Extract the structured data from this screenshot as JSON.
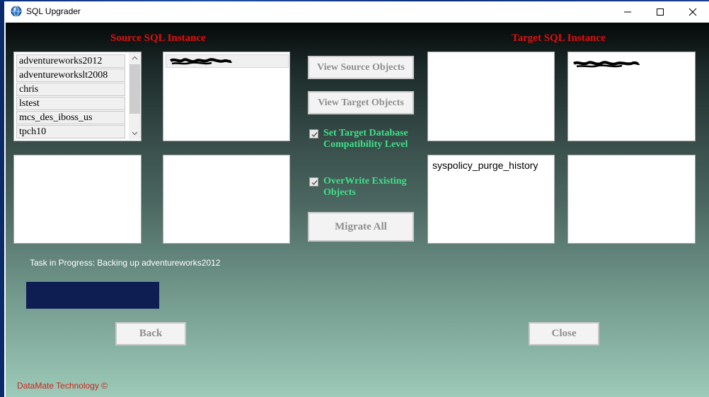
{
  "window": {
    "title": "SQL Upgrader",
    "controls": [
      "minimize",
      "maximize",
      "close"
    ],
    "icon": "app-globe-icon"
  },
  "source": {
    "heading": "Source SQL Instance",
    "databases": [
      "adventureworks2012",
      "adventureworkslt2008",
      "chris",
      "lstest",
      "mcs_des_iboss_us",
      "tpch10"
    ],
    "instance_list_note": "redacted instance name"
  },
  "target": {
    "heading": "Target SQL Instance",
    "objects": [
      "syspolicy_purge_history"
    ]
  },
  "actions": {
    "view_source": "View Source Objects",
    "view_target": "View Target Objects",
    "compat_line1": "Set Target Database",
    "compat_line2": "Compatibility Level",
    "overwrite_line1": "OverWrite Existing",
    "overwrite_line2": "Objects",
    "migrate_all": "Migrate All",
    "compat_checked": true,
    "overwrite_checked": true
  },
  "status": {
    "task": "Task in Progress: Backing up adventureworks2012",
    "progress_fraction": 1.0
  },
  "nav": {
    "back": "Back",
    "close": "Close"
  },
  "footer": {
    "copyright": "DataMate Technology ©"
  },
  "colors": {
    "heading": "#e01010",
    "checkbox_label": "#3fe08a",
    "progress": "#0e1e52",
    "footer": "#d0241c"
  }
}
